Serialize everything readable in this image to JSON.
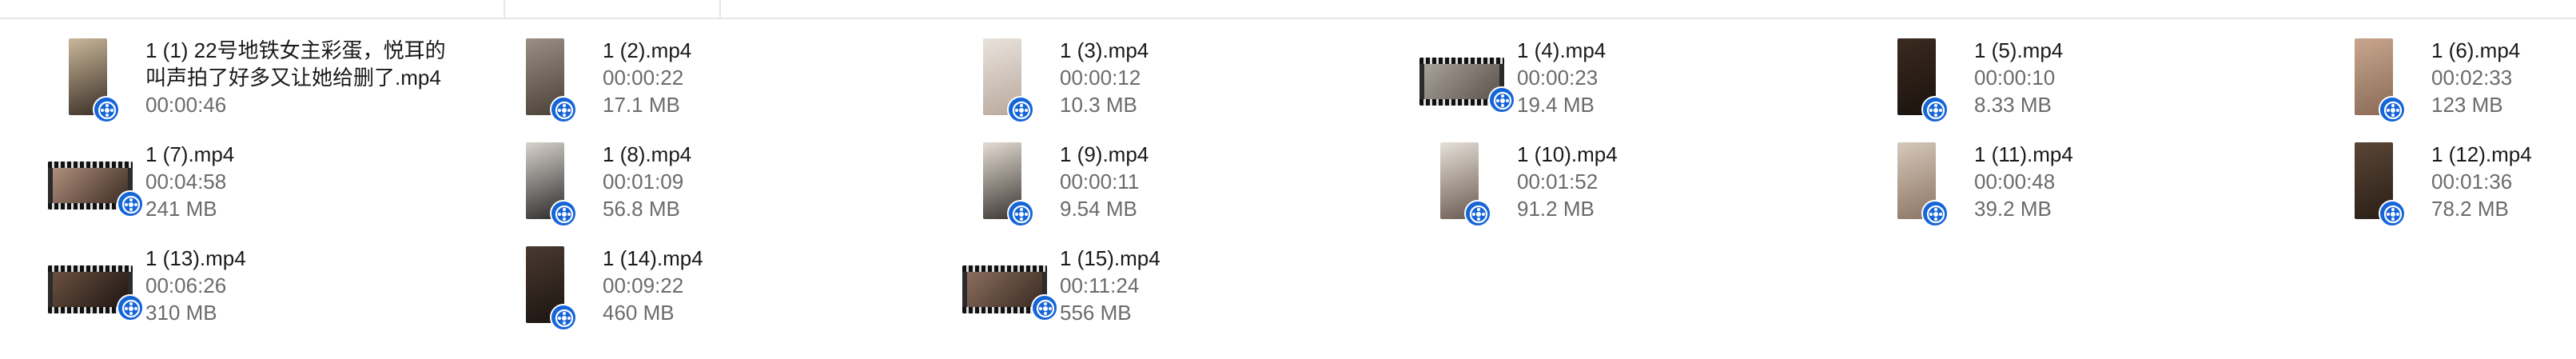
{
  "files": [
    {
      "name": "1 (1) 22号地铁女主彩蛋，悦耳的叫声拍了好多又让她给删了.mp4",
      "duration": "00:00:46",
      "size": "",
      "thumb": "portrait",
      "colors": [
        "#c9b79a",
        "#3a2e25"
      ]
    },
    {
      "name": "1 (2).mp4",
      "duration": "00:00:22",
      "size": "17.1 MB",
      "thumb": "portrait",
      "colors": [
        "#9a8f85",
        "#4a4036"
      ]
    },
    {
      "name": "1 (3).mp4",
      "duration": "00:00:12",
      "size": "10.3 MB",
      "thumb": "portrait",
      "colors": [
        "#e9e3dd",
        "#b8a89c"
      ]
    },
    {
      "name": "1 (4).mp4",
      "duration": "00:00:23",
      "size": "19.4 MB",
      "thumb": "landscape",
      "colors": [
        "#a9a29a",
        "#5a534c"
      ]
    },
    {
      "name": "1 (5).mp4",
      "duration": "00:00:10",
      "size": "8.33 MB",
      "thumb": "portrait",
      "colors": [
        "#3b2a20",
        "#1a120d"
      ]
    },
    {
      "name": "1 (6).mp4",
      "duration": "00:02:33",
      "size": "123 MB",
      "thumb": "portrait",
      "colors": [
        "#c8a68e",
        "#8a6a56"
      ]
    },
    {
      "name": "1 (7).mp4",
      "duration": "00:04:58",
      "size": "241 MB",
      "thumb": "landscape",
      "colors": [
        "#b08f7c",
        "#3c2c24"
      ]
    },
    {
      "name": "1 (8).mp4",
      "duration": "00:01:09",
      "size": "56.8 MB",
      "thumb": "portrait",
      "colors": [
        "#d8d2cc",
        "#2b2b2b"
      ]
    },
    {
      "name": "1 (9).mp4",
      "duration": "00:00:11",
      "size": "9.54 MB",
      "thumb": "portrait",
      "colors": [
        "#e4dcd4",
        "#3a3530"
      ]
    },
    {
      "name": "1 (10).mp4",
      "duration": "00:01:52",
      "size": "91.2 MB",
      "thumb": "portrait",
      "colors": [
        "#e6e0d8",
        "#6a5a50"
      ]
    },
    {
      "name": "1 (11).mp4",
      "duration": "00:00:48",
      "size": "39.2 MB",
      "thumb": "portrait",
      "colors": [
        "#d6c8ba",
        "#8b7464"
      ]
    },
    {
      "name": "1 (12).mp4",
      "duration": "00:01:36",
      "size": "78.2 MB",
      "thumb": "portrait",
      "colors": [
        "#5a4636",
        "#2a1e16"
      ]
    },
    {
      "name": "1 (13).mp4",
      "duration": "00:06:26",
      "size": "310 MB",
      "thumb": "landscape",
      "colors": [
        "#6b5040",
        "#1e1612"
      ]
    },
    {
      "name": "1 (14).mp4",
      "duration": "00:09:22",
      "size": "460 MB",
      "thumb": "portrait",
      "colors": [
        "#4a3a30",
        "#1a1410"
      ]
    },
    {
      "name": "1 (15).mp4",
      "duration": "00:11:24",
      "size": "556 MB",
      "thumb": "landscape",
      "colors": [
        "#8a6e5e",
        "#3a2a22"
      ]
    }
  ],
  "theme": {
    "badge": "#1565d8",
    "text": "#1a1a1a",
    "subtext": "#6b6b6b"
  },
  "icons": {
    "badge": "video-player-icon"
  }
}
